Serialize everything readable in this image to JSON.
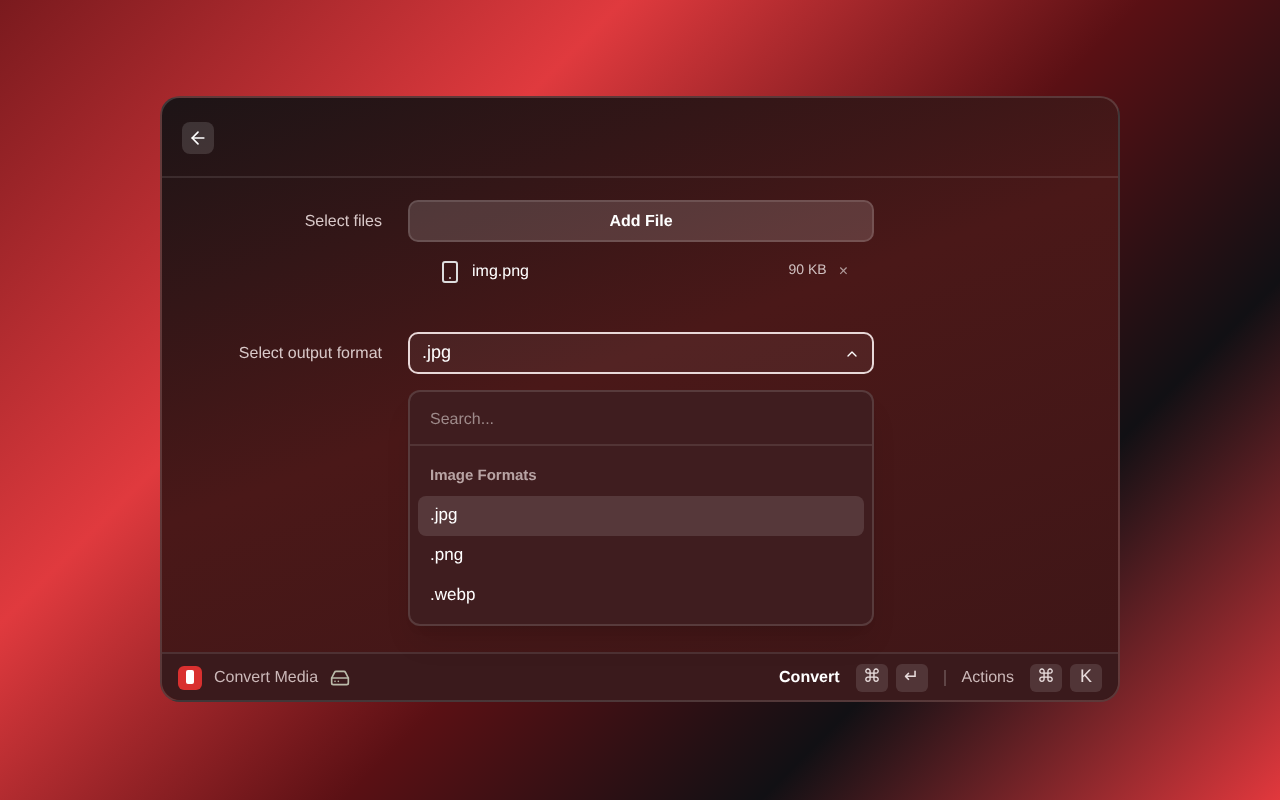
{
  "form": {
    "files_label": "Select files",
    "add_button": "Add File",
    "files": [
      {
        "name": "img.png",
        "size": "90 KB",
        "remove": "×"
      }
    ],
    "format_label": "Select output format",
    "format_value": ".jpg",
    "expanded": true
  },
  "dropdown": {
    "placeholder": "Search...",
    "section": "Image Formats",
    "options": [
      {
        "label": ".jpg",
        "selected": true
      },
      {
        "label": ".png",
        "selected": false
      },
      {
        "label": ".webp",
        "selected": false
      }
    ]
  },
  "footer": {
    "title": "Convert Media",
    "primary": "Convert",
    "primary_keys": [
      "⌘",
      "↵"
    ],
    "actions": "Actions",
    "actions_keys": [
      "⌘",
      "K"
    ]
  }
}
